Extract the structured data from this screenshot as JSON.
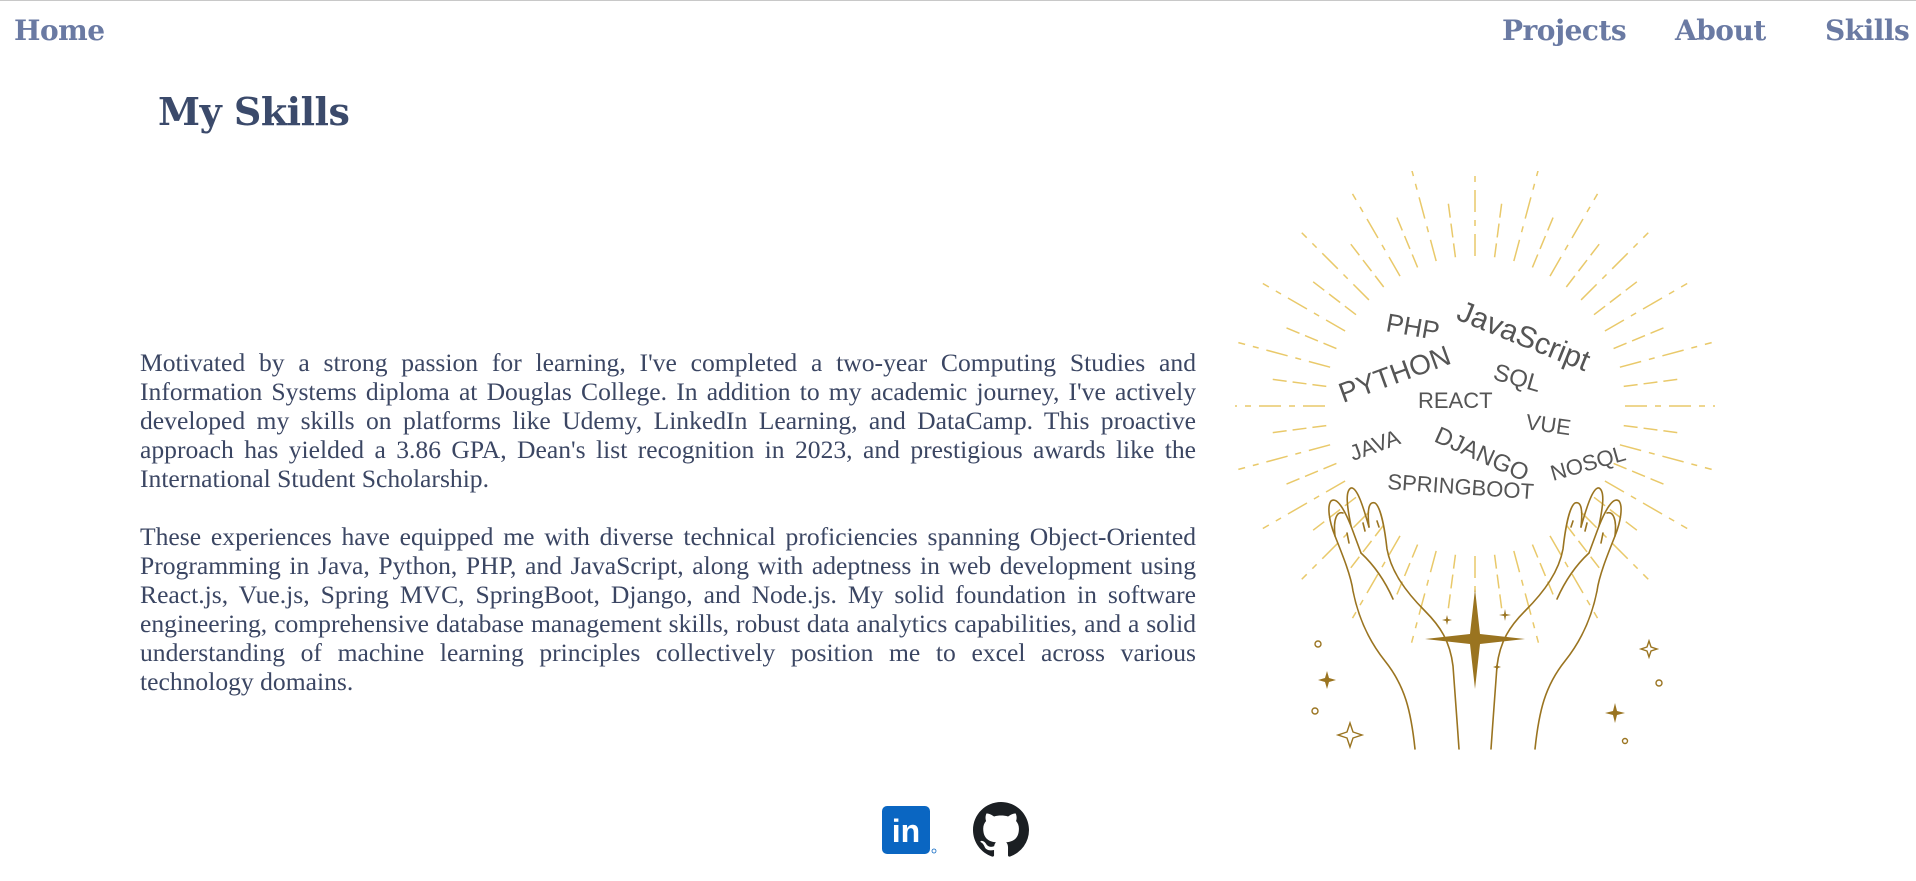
{
  "nav": {
    "home": "Home",
    "projects": "Projects",
    "about": "About",
    "skills": "Skills"
  },
  "page": {
    "title": "My Skills"
  },
  "content": {
    "paragraphs": [
      "Motivated by a strong passion for learning, I've completed a two-year Computing Studies and Information Systems diploma at Douglas College. In addition to my academic journey, I've actively developed my skills on platforms like Udemy, LinkedIn Learning, and DataCamp. This proactive approach has yielded a 3.86 GPA, Dean's list recognition in 2023, and prestigious awards like the International Student Scholarship.",
      "These experiences have equipped me with diverse technical proficiencies spanning Object-Oriented Programming in Java, Python, PHP, and JavaScript, along with adeptness in web development using React.js, Vue.js, Spring MVC, SpringBoot, Django, and Node.js. My solid foundation in software engineering, comprehensive database management skills, robust data analytics capabilities, and a solid understanding of machine learning principles collectively position me to excel across various technology domains."
    ]
  },
  "illustration": {
    "words": [
      "PHP",
      "JavaScript",
      "PYTHON",
      "SQL",
      "REACT",
      "VUE",
      "JAVA",
      "DJANGO",
      "NOSQL",
      "SPRINGBOOT"
    ],
    "ray_color": "#e9c96a",
    "hand_color": "#9a7420"
  },
  "social": {
    "linkedin_icon": "linkedin-icon",
    "linkedin_color": "#0a66c2",
    "linkedin_mark": "in",
    "github_icon": "github-icon",
    "github_color": "#1b1f23"
  }
}
